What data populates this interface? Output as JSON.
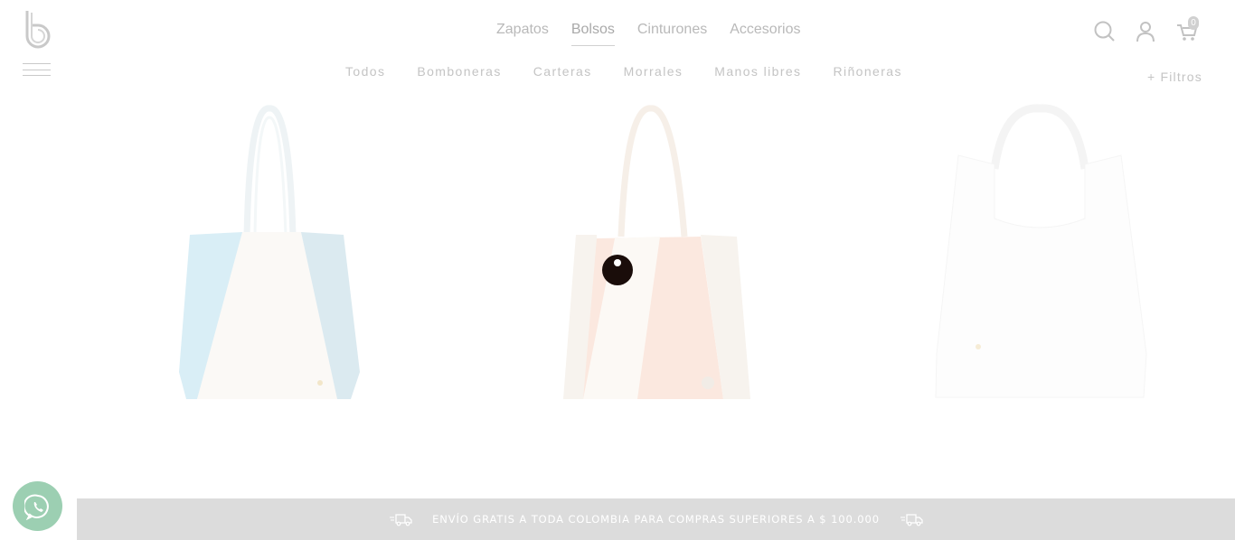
{
  "brand": {
    "logo_icon": "b-logo-icon"
  },
  "menu": {
    "icon": "hamburger-menu-icon"
  },
  "main_nav": {
    "items": [
      {
        "label": "Zapatos",
        "active": false
      },
      {
        "label": "Bolsos",
        "active": true
      },
      {
        "label": "Cinturones",
        "active": false
      },
      {
        "label": "Accesorios",
        "active": false
      }
    ]
  },
  "sub_nav": {
    "items": [
      {
        "label": "Todos"
      },
      {
        "label": "Bomboneras"
      },
      {
        "label": "Carteras"
      },
      {
        "label": "Morrales"
      },
      {
        "label": "Manos libres"
      },
      {
        "label": "Riñoneras"
      }
    ]
  },
  "filters": {
    "label": "+ Filtros"
  },
  "header_icons": {
    "search": "search-icon",
    "account": "user-icon",
    "cart": "cart-icon",
    "cart_count": "0"
  },
  "products": [
    {
      "name": "tote-bag-blue-cream",
      "colors": [
        "#d9eef6",
        "#fbf9f6",
        "#e8f3f8"
      ]
    },
    {
      "name": "tote-bag-peach-cream",
      "colors": [
        "#fbe8df",
        "#fcfaf7",
        "#f8f4ef"
      ]
    },
    {
      "name": "hobo-bag-white",
      "colors": [
        "#fdfdfd"
      ]
    }
  ],
  "whatsapp": {
    "icon": "whatsapp-icon"
  },
  "promo": {
    "text": "ENVÍO GRATIS A TODA COLOMBIA PARA COMPRAS SUPERIORES A $ 100.000",
    "icon": "truck-icon"
  }
}
